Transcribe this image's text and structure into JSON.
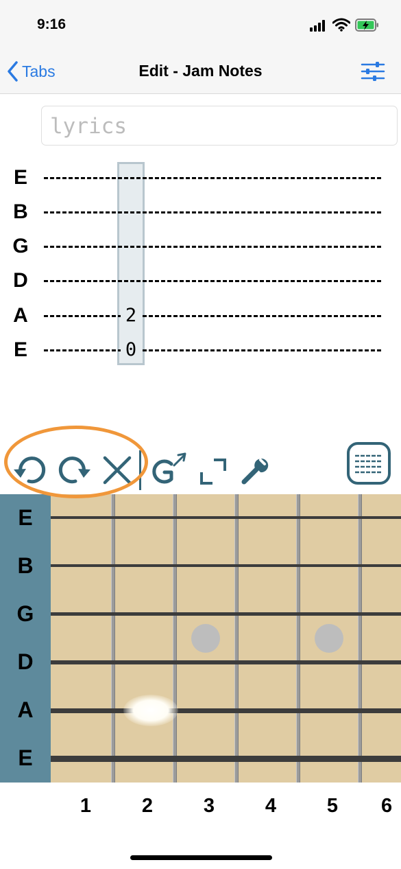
{
  "status_bar": {
    "time": "9:16"
  },
  "nav": {
    "back_label": "Tabs",
    "title": "Edit - Jam Notes",
    "accent_color": "#2a7ae2"
  },
  "lyrics": {
    "placeholder": "lyrics"
  },
  "tab": {
    "strings": [
      "E",
      "B",
      "G",
      "D",
      "A",
      "E"
    ],
    "selected_column_notes": [
      "",
      "",
      "",
      "",
      "2",
      "0"
    ]
  },
  "toolbar": {
    "icons": [
      "undo-icon",
      "redo-icon",
      "clear-icon",
      "chord-icon",
      "fullscreen-icon",
      "wrench-icon",
      "grid-view-icon"
    ],
    "highlight_color": "#f0973a",
    "icon_color": "#336477"
  },
  "fretboard": {
    "strings": [
      "E",
      "B",
      "G",
      "D",
      "A",
      "E"
    ],
    "fret_numbers": [
      "1",
      "2",
      "3",
      "4",
      "5",
      "6"
    ],
    "inlay_frets": [
      3,
      5
    ],
    "pressed": {
      "string": "A",
      "fret": 2
    }
  }
}
